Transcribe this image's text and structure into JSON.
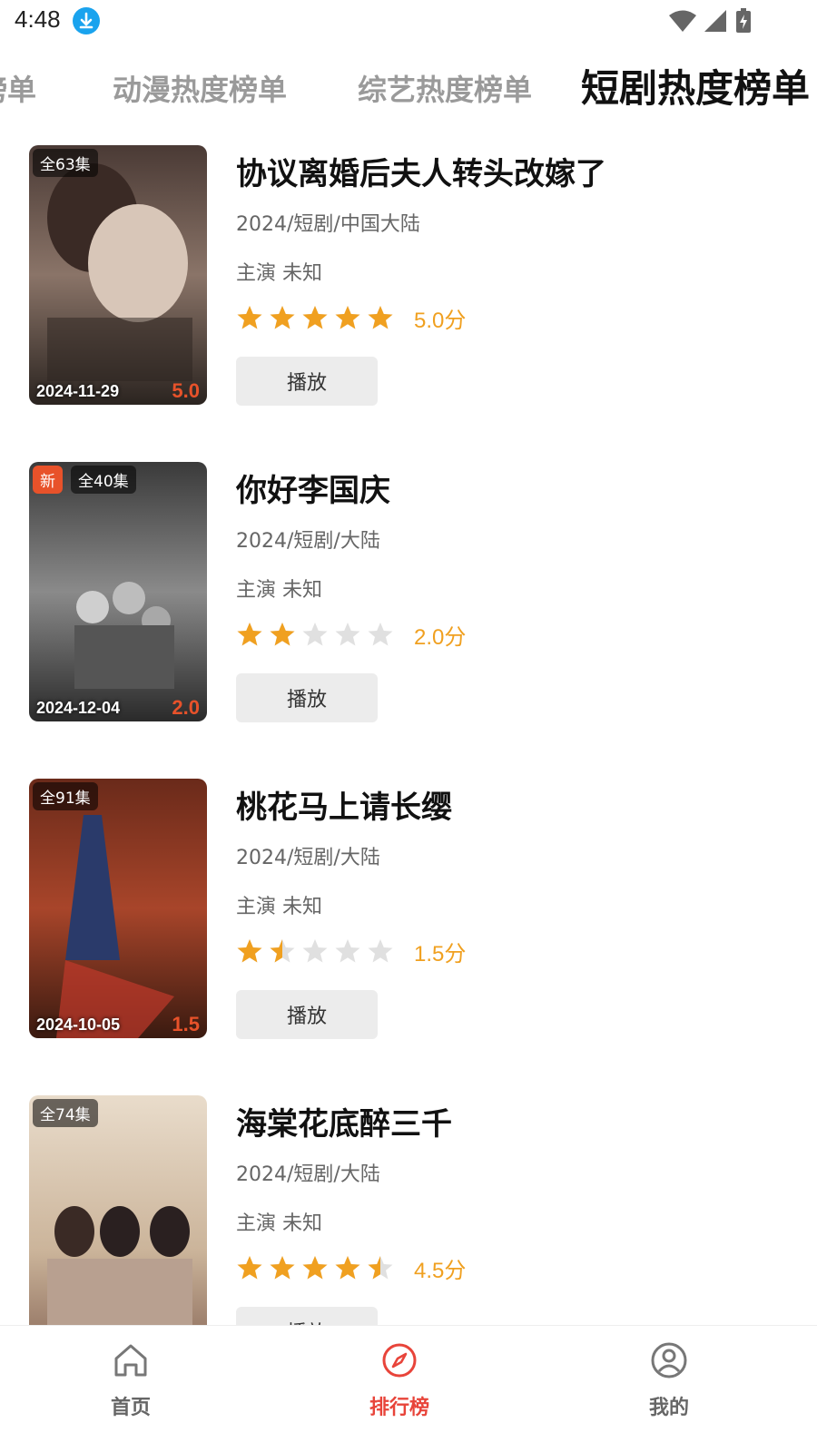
{
  "status_bar": {
    "time": "4:48"
  },
  "tabs": [
    {
      "label": "榜单",
      "active": false
    },
    {
      "label": "动漫热度榜单",
      "active": false
    },
    {
      "label": "综艺热度榜单",
      "active": false
    },
    {
      "label": "短剧热度榜单",
      "active": true
    }
  ],
  "items": [
    {
      "title": "协议离婚后夫人转头改嫁了",
      "meta": "2024/短剧/中国大陆",
      "cast": "主演 未知",
      "rating": 5.0,
      "score_label": "5.0分",
      "episodes": "全63集",
      "new_badge": "",
      "date": "2024-11-29",
      "poster_score": "5.0",
      "play_label": "播放"
    },
    {
      "title": "你好李国庆",
      "meta": "2024/短剧/大陆",
      "cast": "主演 未知",
      "rating": 2.0,
      "score_label": "2.0分",
      "episodes": "全40集",
      "new_badge": "新",
      "date": "2024-12-04",
      "poster_score": "2.0",
      "play_label": "播放"
    },
    {
      "title": "桃花马上请长缨",
      "meta": "2024/短剧/大陆",
      "cast": "主演 未知",
      "rating": 1.5,
      "score_label": "1.5分",
      "episodes": "全91集",
      "new_badge": "",
      "date": "2024-10-05",
      "poster_score": "1.5",
      "play_label": "播放"
    },
    {
      "title": "海棠花底醉三千",
      "meta": "2024/短剧/大陆",
      "cast": "主演 未知",
      "rating": 4.5,
      "score_label": "4.5分",
      "episodes": "全74集",
      "new_badge": "",
      "date": "",
      "poster_score": "",
      "play_label": "播放"
    }
  ],
  "bottom_nav": [
    {
      "label": "首页",
      "icon": "home-icon",
      "active": false
    },
    {
      "label": "排行榜",
      "icon": "compass-icon",
      "active": true
    },
    {
      "label": "我的",
      "icon": "profile-icon",
      "active": false
    }
  ],
  "colors": {
    "accent": "#e8443a",
    "star": "#f0a020",
    "star_empty": "#e0e0e0",
    "badge_new": "#e8522a"
  }
}
